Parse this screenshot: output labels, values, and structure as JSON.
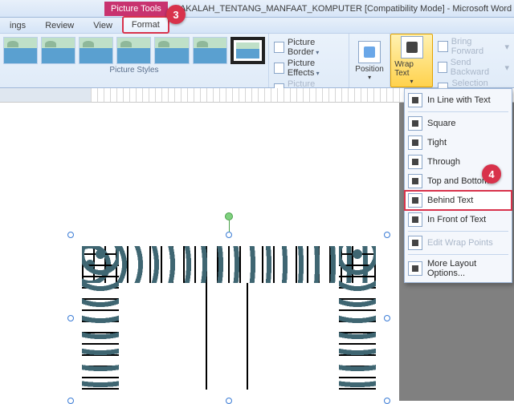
{
  "window": {
    "picture_tools_label": "Picture Tools",
    "doc_title": "MAKALAH_TENTANG_MANFAAT_KOMPUTER [Compatibility Mode] - Microsoft Word"
  },
  "tabs": {
    "mailings_partial": "ings",
    "review": "Review",
    "view": "View",
    "format": "Format"
  },
  "callouts": {
    "three": "3",
    "four": "4"
  },
  "ribbon": {
    "picture_styles_label": "Picture Styles",
    "picture_border": "Picture Border",
    "picture_effects": "Picture Effects",
    "picture_layout": "Picture Layout",
    "position": "Position",
    "wrap_text": "Wrap Text",
    "bring_forward": "Bring Forward",
    "send_backward": "Send Backward",
    "selection_pane": "Selection Pane"
  },
  "menu": {
    "inline": "In Line with Text",
    "square": "Square",
    "tight": "Tight",
    "through": "Through",
    "top_bottom": "Top and Bottom",
    "behind": "Behind Text",
    "front": "In Front of Text",
    "edit_points": "Edit Wrap Points",
    "more": "More Layout Options..."
  }
}
